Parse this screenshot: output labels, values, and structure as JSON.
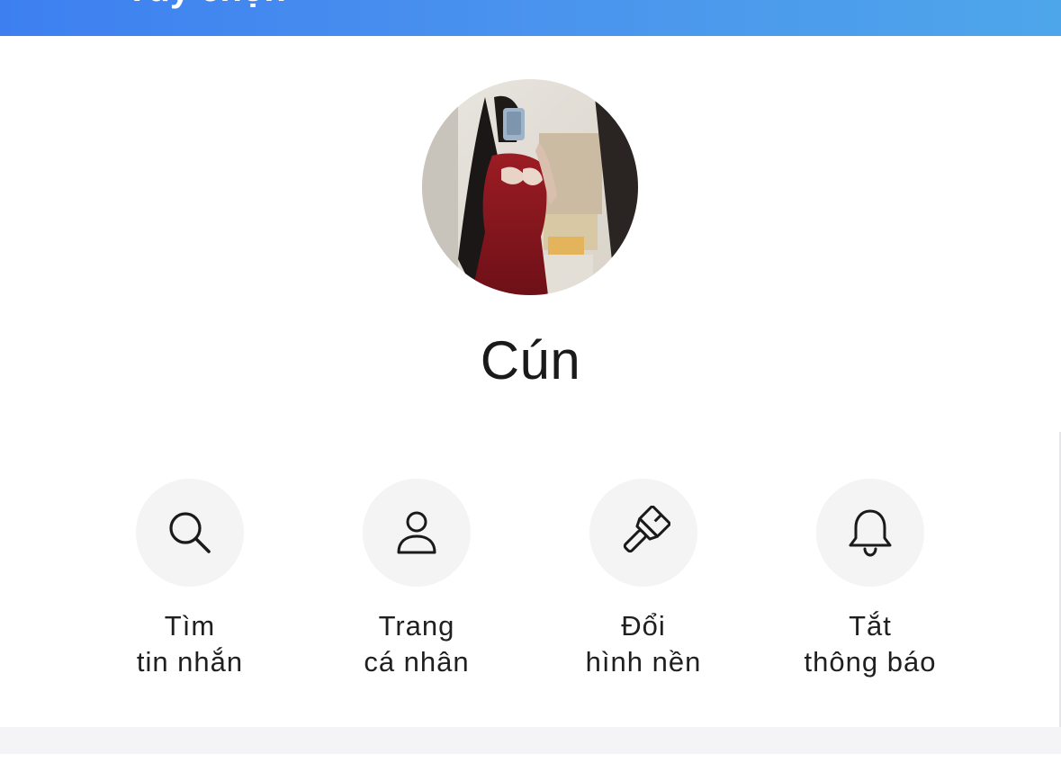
{
  "header": {
    "title": "Tùy chọn",
    "accent_color": "#3d7ff0"
  },
  "profile": {
    "name": "Cún",
    "avatar_description": "profile-photo"
  },
  "actions": [
    {
      "icon": "search-icon",
      "line1": "Tìm",
      "line2": "tin nhắn"
    },
    {
      "icon": "person-icon",
      "line1": "Trang",
      "line2": "cá nhân"
    },
    {
      "icon": "paintbrush-icon",
      "line1": "Đổi",
      "line2": "hình nền"
    },
    {
      "icon": "bell-icon",
      "line1": "Tắt",
      "line2": "thông báo"
    }
  ]
}
